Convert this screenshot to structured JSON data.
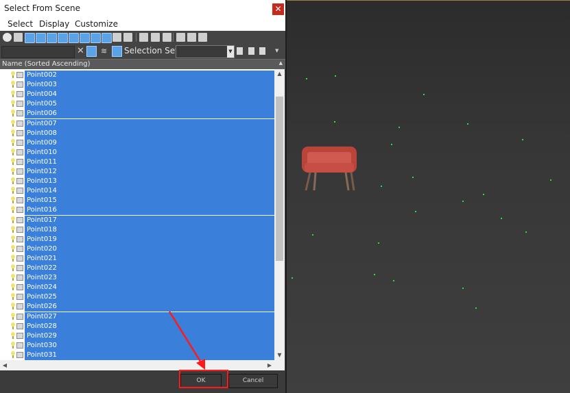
{
  "dialog": {
    "title": "Select From Scene",
    "close_glyph": "✕",
    "menu": [
      "Select",
      "Display",
      "Customize"
    ],
    "filter": {
      "find_value": "",
      "clear_glyph": "✕",
      "selection_set_label": "Selection Set:",
      "selection_set_value": ""
    },
    "column_header": "Name (Sorted Ascending)",
    "items": [
      "Point002",
      "Point003",
      "Point004",
      "Point005",
      "Point006",
      "Point007",
      "Point008",
      "Point009",
      "Point010",
      "Point011",
      "Point012",
      "Point013",
      "Point014",
      "Point015",
      "Point016",
      "Point017",
      "Point018",
      "Point019",
      "Point020",
      "Point021",
      "Point022",
      "Point023",
      "Point024",
      "Point025",
      "Point026",
      "Point027",
      "Point028",
      "Point029",
      "Point030",
      "Point031"
    ],
    "ok_label": "OK",
    "cancel_label": "Cancel"
  },
  "colors": {
    "selection": "#3a7fd9",
    "annotation": "#ff1a1a",
    "point_helper": "#23e14a",
    "close": "#c42b1c"
  },
  "icons": [
    "close-icon",
    "display-all-icon",
    "display-none-icon",
    "invert-icon",
    "geometry-filter-icon",
    "shape-filter-icon",
    "light-filter-icon",
    "camera-filter-icon",
    "helper-filter-icon",
    "spacewarp-filter-icon",
    "group-filter-icon",
    "xref-filter-icon",
    "bone-filter-icon",
    "select-all-icon",
    "select-none-icon",
    "select-invert-icon",
    "filter-icon",
    "hierarchy-icon",
    "pin-icon",
    "layer-icon",
    "selection-set-icon",
    "light-icon",
    "object-icon",
    "chair-model"
  ],
  "viewport": {
    "label": "perspective viewport"
  }
}
